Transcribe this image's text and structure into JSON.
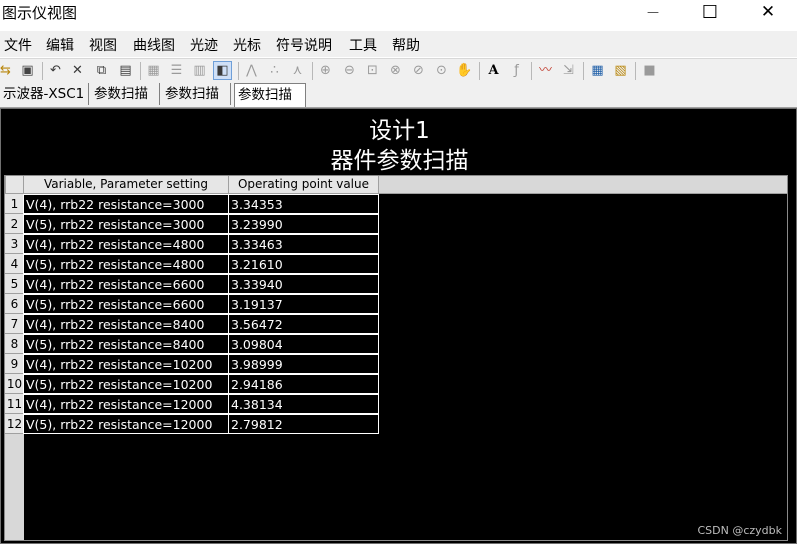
{
  "window": {
    "title": "图示仪视图",
    "minimize": "—",
    "maximize": "☐",
    "close": "✕"
  },
  "menu": [
    "文件",
    "编辑",
    "视图",
    "曲线图",
    "光迹",
    "光标",
    "符号说明",
    "工具",
    "帮助"
  ],
  "toolbar_icons": [
    "open-icon",
    "save-icon",
    "undo-icon",
    "cut-icon",
    "copy-icon",
    "paste-icon",
    "grid-icon",
    "list-icon",
    "chart-icon",
    "overlay-icon",
    "trace-line-icon",
    "trace-dots-icon",
    "trace-markers-icon",
    "zoom-in-icon",
    "zoom-out-icon",
    "zoom-fit-icon",
    "zoom-x-icon",
    "zoom-y-icon",
    "zoom-area-icon",
    "pan-hand-icon",
    "text-icon",
    "formula-icon",
    "waveform-icon",
    "export-icon",
    "copy-view-icon",
    "paste-view-icon",
    "stop-icon"
  ],
  "tabs": [
    "示波器-XSC1",
    "参数扫描",
    "参数扫描",
    "参数扫描"
  ],
  "active_tab_index": 3,
  "plot": {
    "title": "设计1",
    "subtitle": "器件参数扫描"
  },
  "table": {
    "columns": [
      "Variable, Parameter setting",
      "Operating point value"
    ],
    "rows": [
      [
        "1",
        "V(4), rrb22 resistance=3000",
        "3.34353"
      ],
      [
        "2",
        "V(5), rrb22 resistance=3000",
        "3.23990"
      ],
      [
        "3",
        "V(4), rrb22 resistance=4800",
        "3.33463"
      ],
      [
        "4",
        "V(5), rrb22 resistance=4800",
        "3.21610"
      ],
      [
        "5",
        "V(4), rrb22 resistance=6600",
        "3.33940"
      ],
      [
        "6",
        "V(5), rrb22 resistance=6600",
        "3.19137"
      ],
      [
        "7",
        "V(4), rrb22 resistance=8400",
        "3.56472"
      ],
      [
        "8",
        "V(5), rrb22 resistance=8400",
        "3.09804"
      ],
      [
        "9",
        "V(4), rrb22 resistance=10200",
        "3.98999"
      ],
      [
        "10",
        "V(5), rrb22 resistance=10200",
        "2.94186"
      ],
      [
        "11",
        "V(4), rrb22 resistance=12000",
        "4.38134"
      ],
      [
        "12",
        "V(5), rrb22 resistance=12000",
        "2.79812"
      ]
    ]
  },
  "watermark": "CSDN @czydbk",
  "colors": {
    "canvas_bg": "#000000",
    "cell_text": "#ffffff",
    "header_bg": "#e6e6e6",
    "chrome_bg": "#f0f0f0"
  }
}
